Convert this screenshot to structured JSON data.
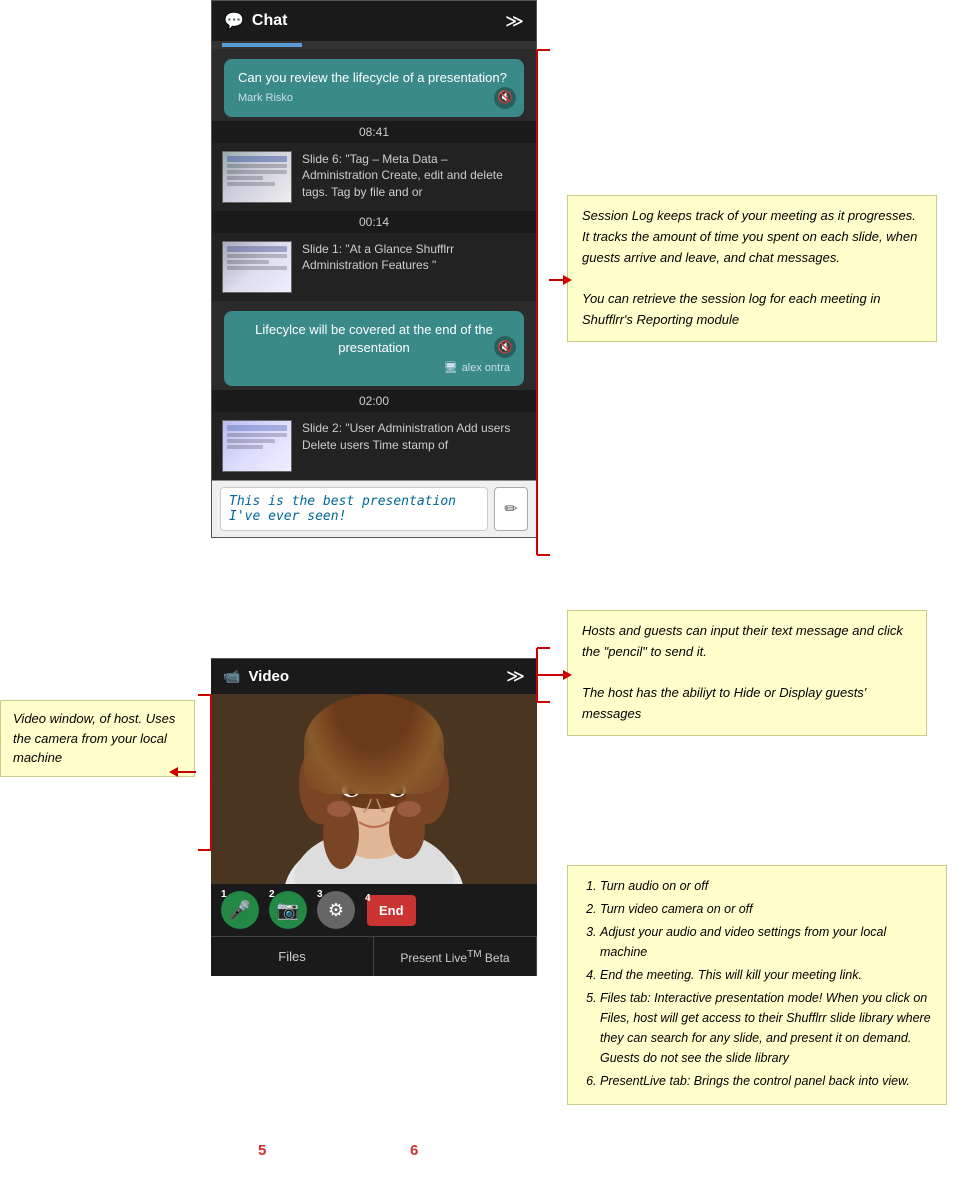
{
  "header": {
    "title": "Chat",
    "chat_icon": "💬",
    "collapse_icon": "≫"
  },
  "chat": {
    "messages": [
      {
        "type": "bubble_teal",
        "text": "Can you review the lifecycle of a presentation?",
        "sender": "Mark Risko"
      },
      {
        "type": "timestamp",
        "value": "08:41"
      },
      {
        "type": "slide",
        "thumb_color": "#889",
        "text": "Slide 6: \"Tag – Meta Data – Administration Create, edit and delete tags. Tag by file and or"
      },
      {
        "type": "timestamp",
        "value": "00:14"
      },
      {
        "type": "slide",
        "thumb_color": "#aab",
        "text": "Slide 1: \"At a Glance Shufflrr Administration Features \""
      },
      {
        "type": "reply_bubble",
        "text": "Lifecylce will be covered at the end of the presentation",
        "sender": "alex ontra"
      },
      {
        "type": "timestamp",
        "value": "02:00"
      },
      {
        "type": "slide",
        "thumb_color": "#99a",
        "text": "Slide 2: \"User Administration Add users Delete users Time stamp of"
      }
    ],
    "input_placeholder": "This is the best presentation I've ever seen!",
    "send_icon": "✏"
  },
  "video": {
    "title": "Video",
    "icon": "📹",
    "collapse_icon": "≫"
  },
  "controls": {
    "buttons": [
      {
        "num": "1",
        "icon": "🎤",
        "type": "mic"
      },
      {
        "num": "2",
        "icon": "📷",
        "type": "cam"
      },
      {
        "num": "3",
        "icon": "⚙",
        "type": "settings"
      },
      {
        "num": "4",
        "label": "End",
        "type": "end"
      }
    ]
  },
  "tabs": [
    {
      "label": "Files",
      "num": "5"
    },
    {
      "label": "Present Live™ Beta",
      "num": "6"
    }
  ],
  "annotations": {
    "session_log": {
      "title": "",
      "text1": "Session Log keeps track of your meeting as it progresses. It tracks the amount of time you spent on each slide, when guests arrive and leave, and chat messages.",
      "text2": "You can retrieve the session log for each meeting in Shufflrr's Reporting module"
    },
    "chat_input": {
      "text1": "Hosts and guests can input their text message and click the \"pencil\" to send it.",
      "text2": "The host has the abiliyt to Hide or Display guests' messages"
    },
    "video": {
      "text": "Video window, of host. Uses the camera from your local machine"
    },
    "controls": {
      "items": [
        "Turn audio on or off",
        "Turn video camera on or off",
        "Adjust your audio and video settings from your local machine",
        "End the meeting. This will kill your meeting link.",
        "Files tab: Interactive presentation mode! When you click on Files, host will get access to their Shufflrr slide library where they can search for any slide, and present it on demand. Guests do not see the slide library",
        "PresentLive tab: Brings the control panel back into view."
      ]
    }
  },
  "nums": {
    "five": "5",
    "six": "6"
  }
}
